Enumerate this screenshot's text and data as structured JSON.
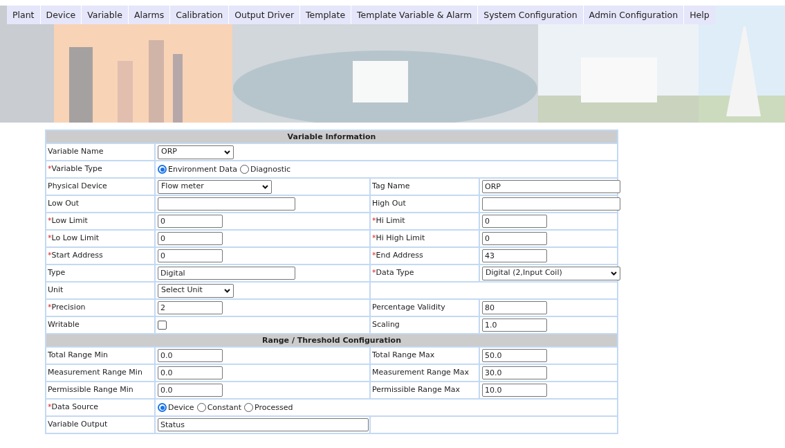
{
  "menu": [
    {
      "label": "Plant"
    },
    {
      "label": "Device"
    },
    {
      "label": "Variable"
    },
    {
      "label": "Alarms"
    },
    {
      "label": "Calibration"
    },
    {
      "label": "Output Driver"
    },
    {
      "label": "Template"
    },
    {
      "label": "Template Variable & Alarm"
    },
    {
      "label": "System Configuration"
    },
    {
      "label": "Admin Configuration"
    },
    {
      "label": "Help"
    }
  ],
  "sections": [
    {
      "title": "Variable Information",
      "rows": [
        {
          "kind": "full",
          "left": {
            "label": "Variable Name",
            "field": {
              "kind": "select",
              "value": "ORP"
            }
          }
        },
        {
          "kind": "full",
          "left": {
            "label": "Variable Type",
            "required_mark": "*",
            "field": {
              "kind": "radio",
              "options": [
                {
                  "label": "Environment Data",
                  "selected": true
                },
                {
                  "label": "Diagnostic",
                  "selected": false
                }
              ]
            }
          }
        },
        {
          "kind": "half",
          "left": {
            "label": "Physical Device",
            "field": {
              "kind": "select",
              "value": "Flow meter"
            }
          },
          "right": {
            "label": "Tag Name",
            "field": {
              "kind": "text",
              "value": "ORP"
            }
          }
        },
        {
          "kind": "half",
          "left": {
            "label": "Low Out",
            "field": {
              "kind": "text"
            }
          },
          "right": {
            "label": "High Out",
            "field": {
              "kind": "text"
            }
          }
        },
        {
          "kind": "half",
          "left": {
            "label": "Low Limit",
            "required_mark": "*",
            "field": {
              "kind": "text",
              "value": "0"
            }
          },
          "right": {
            "label": "Hi Limit",
            "required_mark": "*",
            "field": {
              "kind": "text",
              "value": "0"
            }
          }
        },
        {
          "kind": "half",
          "left": {
            "label": "Lo Low Limit",
            "required_mark": "*",
            "field": {
              "kind": "text",
              "value": "0"
            }
          },
          "right": {
            "label": "Hi High Limit",
            "required_mark": "*",
            "field": {
              "kind": "text",
              "value": "0"
            }
          }
        },
        {
          "kind": "half",
          "left": {
            "label": "Start Address",
            "required_mark": "*",
            "field": {
              "kind": "text",
              "value": "0"
            }
          },
          "right": {
            "label": "End Address",
            "required_mark": "*",
            "field": {
              "kind": "text",
              "value": "43"
            }
          }
        },
        {
          "kind": "half",
          "left": {
            "label": "Type",
            "field": {
              "kind": "text",
              "value": "Digital"
            }
          },
          "right": {
            "label": "Data Type",
            "required_mark": "*",
            "field": {
              "kind": "select",
              "value": "Digital (2,Input Coil)"
            }
          }
        },
        {
          "kind": "half",
          "left": {
            "label": "Unit",
            "field": {
              "kind": "select",
              "value": "Select Unit"
            }
          }
        },
        {
          "kind": "half",
          "left": {
            "label": "Precision",
            "required_mark": "*",
            "field": {
              "kind": "text",
              "value": "2"
            }
          },
          "right": {
            "label": "Percentage Validity",
            "field": {
              "kind": "text",
              "value": "80"
            }
          }
        },
        {
          "kind": "half",
          "left": {
            "label": "Writable",
            "field": {
              "kind": "checkbox",
              "checked": false
            }
          },
          "right": {
            "label": "Scaling",
            "field": {
              "kind": "text",
              "value": "1.0"
            }
          }
        }
      ]
    },
    {
      "title": "Range / Threshold Configuration",
      "rows": [
        {
          "kind": "half",
          "left": {
            "label": "Total Range Min",
            "field": {
              "kind": "text",
              "value": "0.0"
            }
          },
          "right": {
            "label": "Total Range Max",
            "field": {
              "kind": "text",
              "value": "50.0"
            }
          }
        },
        {
          "kind": "half",
          "left": {
            "label": "Measurement Range Min",
            "field": {
              "kind": "text",
              "value": "0.0"
            }
          },
          "right": {
            "label": "Measurement Range Max",
            "field": {
              "kind": "text",
              "value": "30.0"
            }
          }
        },
        {
          "kind": "half",
          "left": {
            "label": "Permissible Range Min",
            "field": {
              "kind": "text",
              "value": "0.0"
            }
          },
          "right": {
            "label": "Permissible Range Max",
            "field": {
              "kind": "text",
              "value": "10.0"
            }
          }
        },
        {
          "kind": "full",
          "left": {
            "label": "Data Source",
            "required_mark": "*",
            "field": {
              "kind": "radio",
              "options": [
                {
                  "label": "Device",
                  "selected": true
                },
                {
                  "label": "Constant",
                  "selected": false
                },
                {
                  "label": "Processed",
                  "selected": false
                }
              ]
            }
          }
        },
        {
          "kind": "half",
          "left": {
            "label": "Variable Output",
            "field": {
              "kind": "text",
              "value": "Status"
            }
          }
        }
      ]
    }
  ]
}
